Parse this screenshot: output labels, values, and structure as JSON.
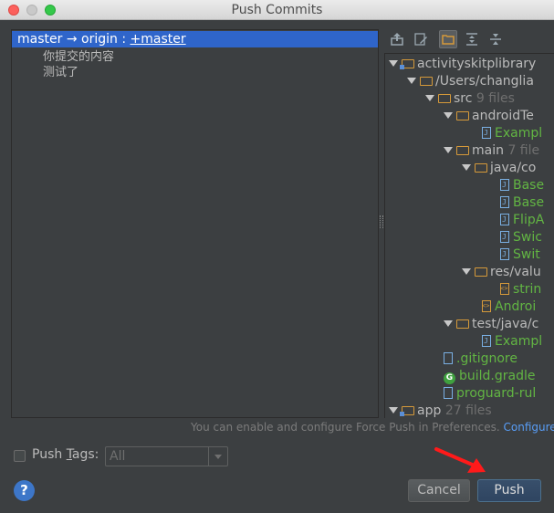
{
  "window": {
    "title": "Push Commits"
  },
  "commits": {
    "branch_local": "master",
    "branch_arrow": " → ",
    "branch_remote": "origin",
    "branch_sep": " : ",
    "branch_target": "+master",
    "messages": [
      "你提交的内容",
      "测试了"
    ]
  },
  "toolbar": {
    "icons": [
      "vcs-push-icon",
      "edit-source-icon",
      "group-by-directory-icon",
      "expand-all-icon",
      "collapse-all-icon"
    ]
  },
  "tree": {
    "nodes": [
      {
        "label": "activityskitplibrary",
        "meta": "",
        "kind": "module"
      },
      {
        "label": "/Users/changlia",
        "meta": "",
        "kind": "folder"
      },
      {
        "label": "src",
        "meta": "9 files",
        "kind": "folder"
      },
      {
        "label": "androidTe",
        "meta": "",
        "kind": "folder"
      },
      {
        "label": "Exampl",
        "meta": "",
        "kind": "java"
      },
      {
        "label": "main",
        "meta": "7 file",
        "kind": "folder"
      },
      {
        "label": "java/co",
        "meta": "",
        "kind": "folder"
      },
      {
        "label": "Base",
        "meta": "",
        "kind": "java"
      },
      {
        "label": "Base",
        "meta": "",
        "kind": "java"
      },
      {
        "label": "FlipA",
        "meta": "",
        "kind": "java"
      },
      {
        "label": "Swic",
        "meta": "",
        "kind": "java"
      },
      {
        "label": "Swit",
        "meta": "",
        "kind": "java"
      },
      {
        "label": "res/valu",
        "meta": "",
        "kind": "folder"
      },
      {
        "label": "strin",
        "meta": "",
        "kind": "xml"
      },
      {
        "label": "Androi",
        "meta": "",
        "kind": "xml"
      },
      {
        "label": "test/java/c",
        "meta": "",
        "kind": "folder"
      },
      {
        "label": "Exampl",
        "meta": "",
        "kind": "java"
      },
      {
        "label": ".gitignore",
        "meta": "",
        "kind": "file"
      },
      {
        "label": "build.gradle",
        "meta": "",
        "kind": "gradle"
      },
      {
        "label": "proguard-rul",
        "meta": "",
        "kind": "file"
      },
      {
        "label": "app",
        "meta": "27 files",
        "kind": "module"
      }
    ]
  },
  "hint": {
    "text": "You can enable and configure Force Push in Preferences.",
    "link": "Configure"
  },
  "push_tags": {
    "label_pre": "Push ",
    "label_u": "T",
    "label_post": "ags:",
    "checked": false,
    "selected": "All"
  },
  "buttons": {
    "help": "?",
    "cancel": "Cancel",
    "push": "Push"
  },
  "colors": {
    "background": "#3c3f41",
    "selection": "#2f65ca",
    "added_file": "#62b543",
    "link": "#589df6"
  }
}
